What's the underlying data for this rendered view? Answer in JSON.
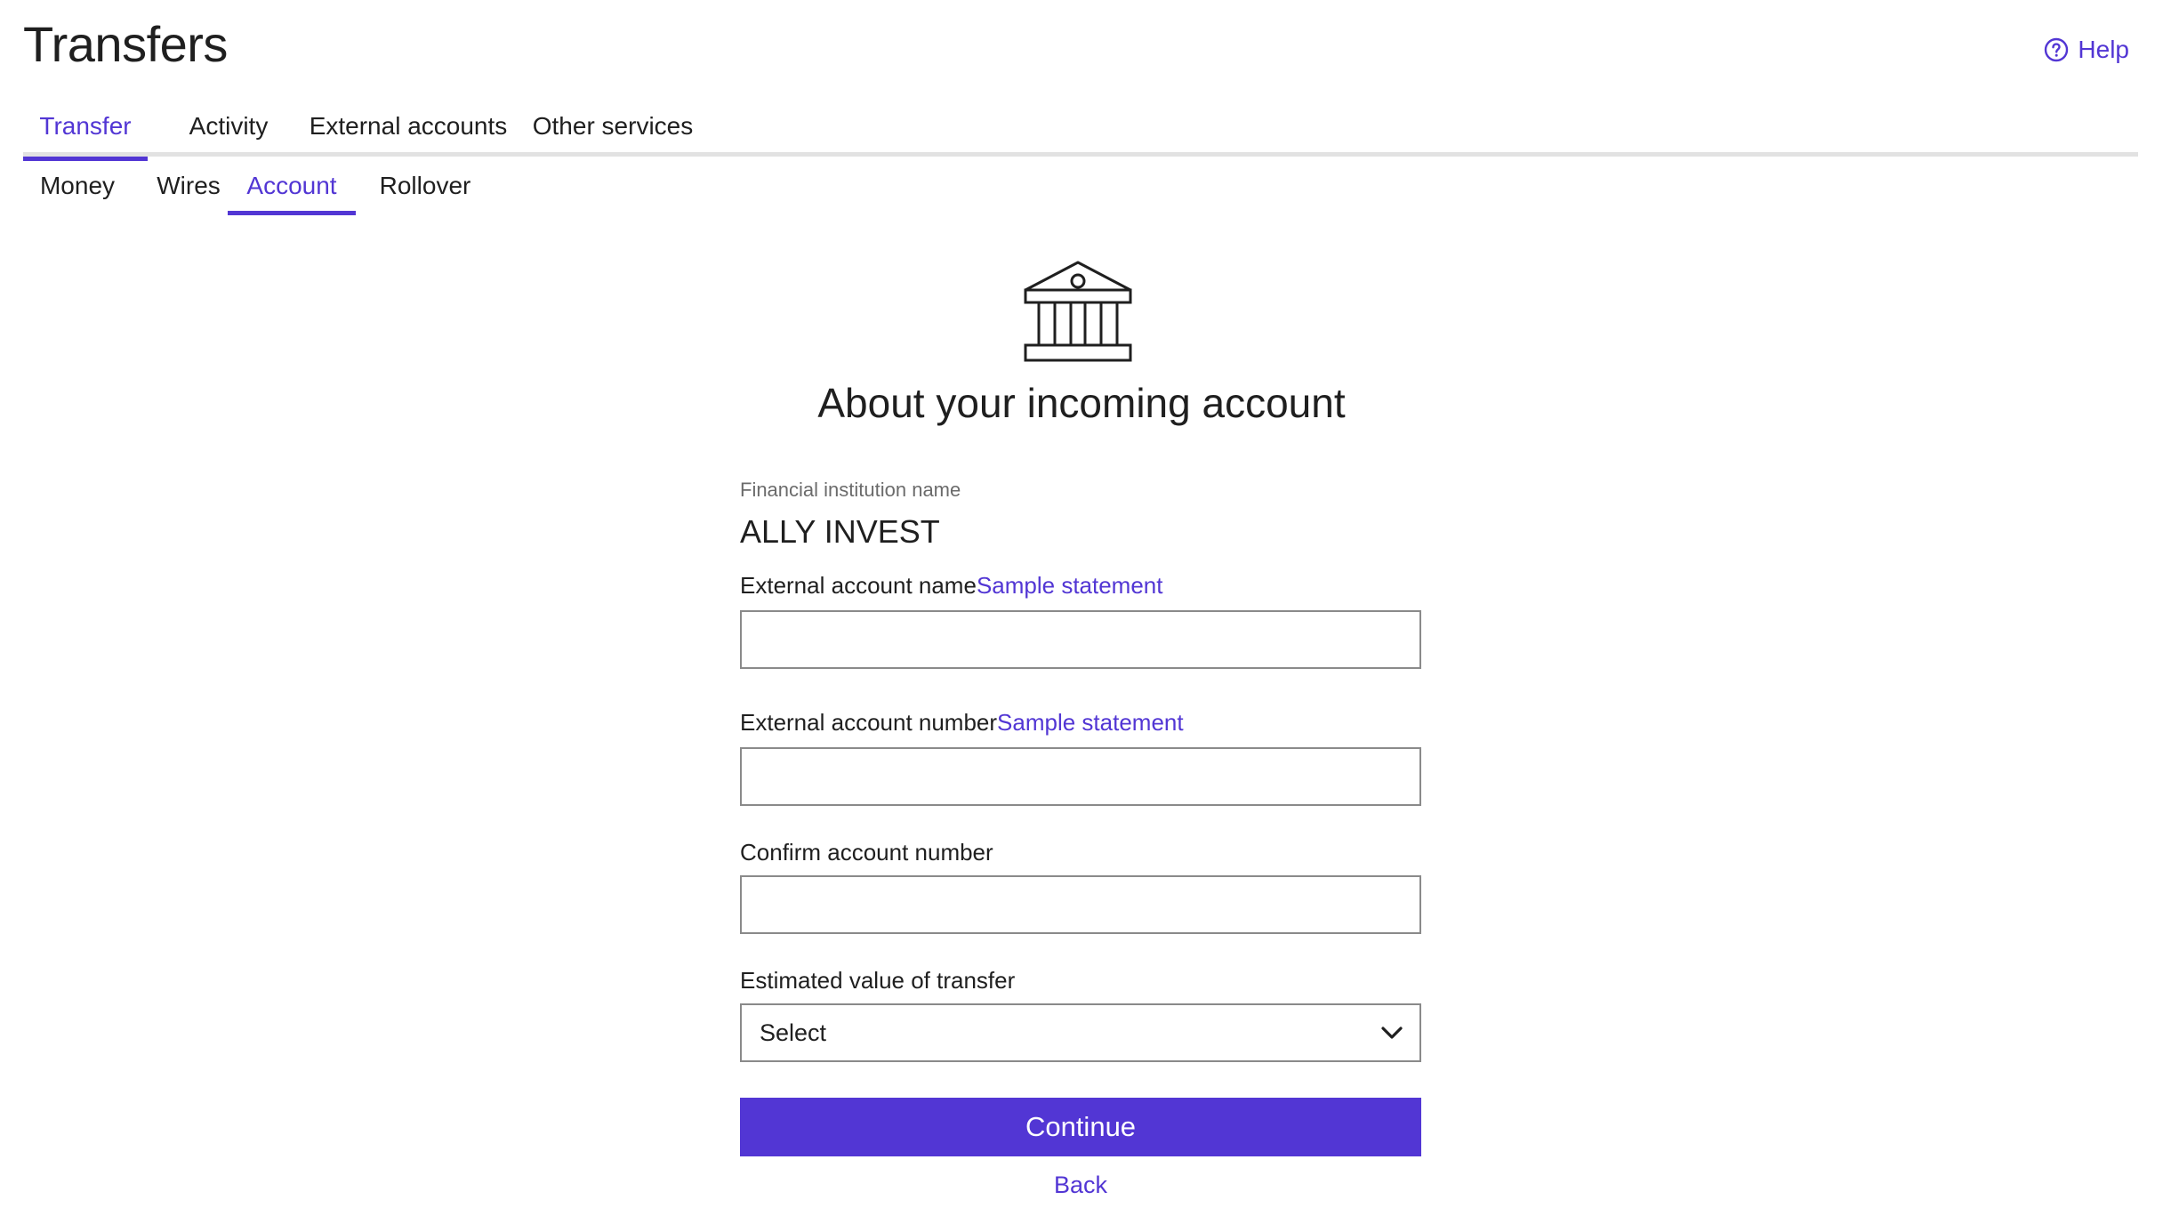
{
  "header": {
    "title": "Transfers",
    "help_label": "Help"
  },
  "tabs_primary": [
    {
      "label": "Transfer",
      "active": true
    },
    {
      "label": "Activity",
      "active": false
    },
    {
      "label": "External accounts",
      "active": false
    },
    {
      "label": "Other services",
      "active": false
    }
  ],
  "tabs_secondary": [
    {
      "label": "Money",
      "active": false
    },
    {
      "label": "Wires",
      "active": false
    },
    {
      "label": "Account",
      "active": true
    },
    {
      "label": "Rollover",
      "active": false
    }
  ],
  "form": {
    "icon": "bank-icon",
    "heading": "About your incoming account",
    "institution_label": "Financial institution name",
    "institution_name": "ALLY INVEST",
    "account_name_label": "External account name",
    "account_name_link": "Sample statement",
    "account_name_value": "",
    "account_number_label": "External account number",
    "account_number_link": "Sample statement",
    "account_number_value": "",
    "confirm_label": "Confirm account number",
    "confirm_value": "",
    "estimate_label": "Estimated value of transfer",
    "estimate_selected": "Select",
    "continue_label": "Continue",
    "back_label": "Back"
  },
  "colors": {
    "accent": "#5236d4",
    "border": "#8a8a8a",
    "tab_rule": "#e2e2e2"
  }
}
